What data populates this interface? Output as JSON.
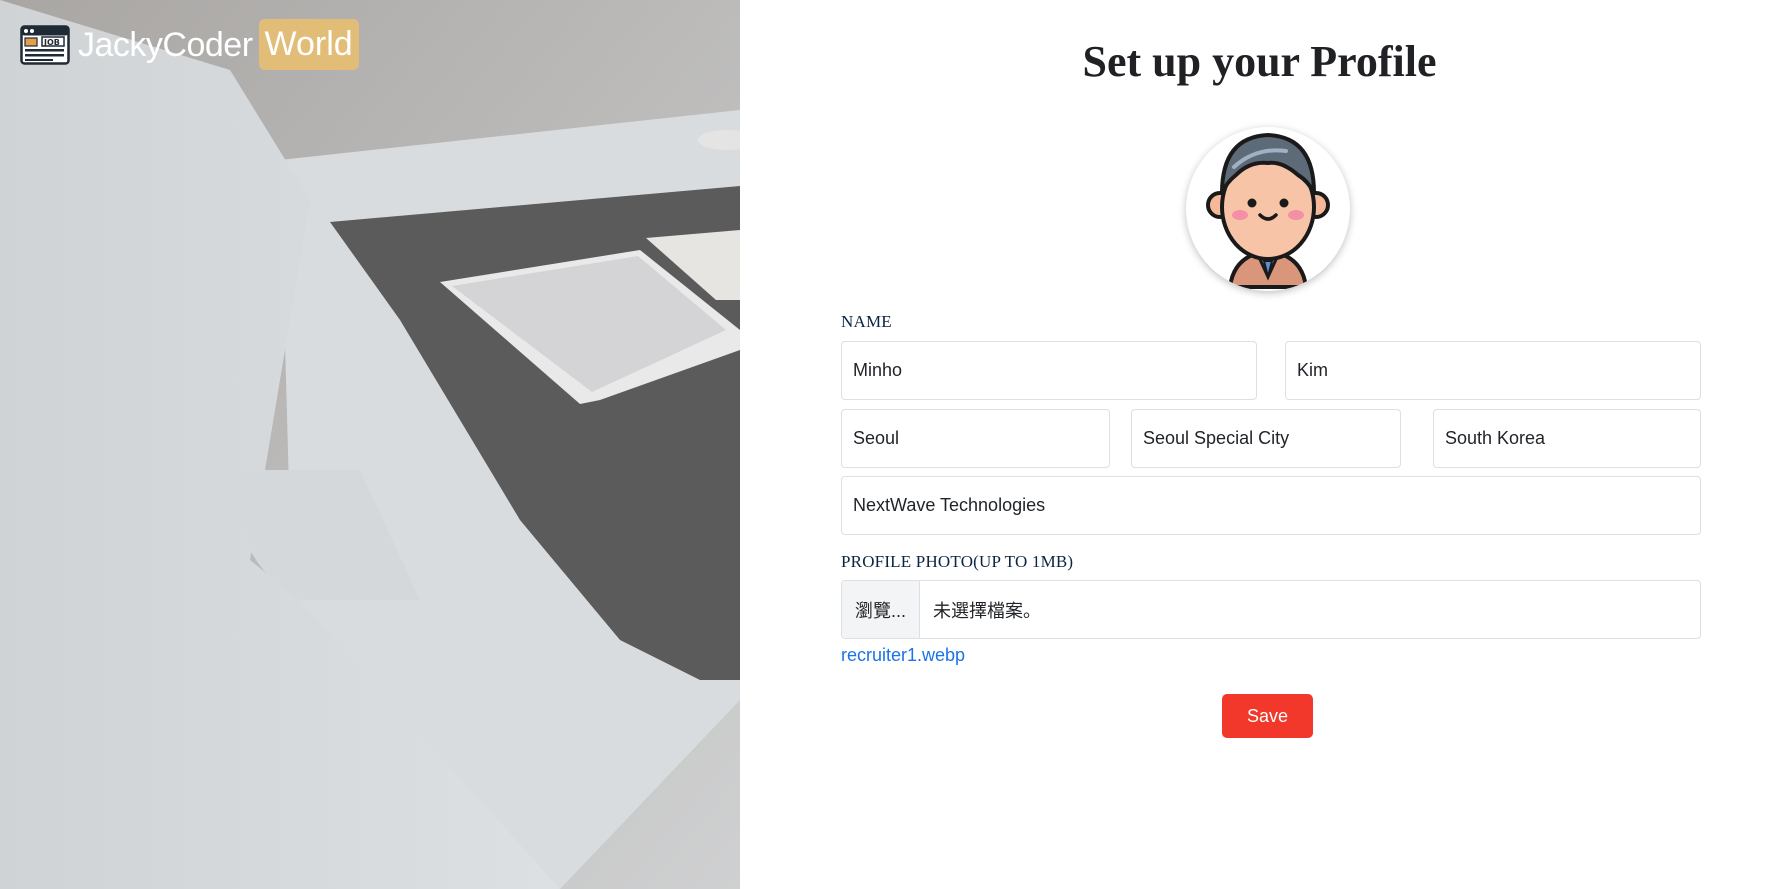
{
  "brand": {
    "name": "JackyCoder",
    "highlight": "World",
    "icon": "job-board-icon"
  },
  "page": {
    "title": "Set up your Profile"
  },
  "avatar": {
    "icon": "recruiter-avatar-icon"
  },
  "form": {
    "name_label": "NAME",
    "first_name": "Minho",
    "last_name": "Kim",
    "city": "Seoul",
    "state": "Seoul Special City",
    "country": "South Korea",
    "company": "NextWave Technologies",
    "photo_label": "PROFILE PHOTO(UP TO 1MB)",
    "file_button": "瀏覽...",
    "file_status": "未選擇檔案。",
    "current_file": "recruiter1.webp",
    "save": "Save"
  },
  "colors": {
    "accent_save": "#f2372b",
    "brand_highlight": "#e2bd78",
    "link": "#1a73e8"
  }
}
